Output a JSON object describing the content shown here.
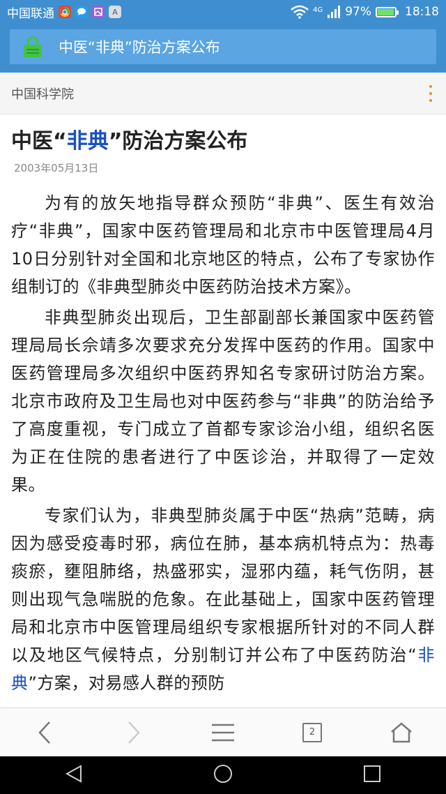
{
  "status_bar": {
    "carrier": "中国联通",
    "app_icons": [
      "chrome-icon",
      "message-icon",
      "gallery-icon",
      "app-a-icon"
    ],
    "app_icon_a_letter": "A",
    "network": "4G",
    "battery": "97%",
    "battery_level": 0.97,
    "time": "18:18"
  },
  "address_bar": {
    "title": "中医“非典”防治方案公布"
  },
  "site_header": {
    "site_name": "中国科学院"
  },
  "article": {
    "title_prefix": "中医“",
    "title_keyword": "非典",
    "title_suffix": "”防治方案公布",
    "date": "2003年05月13日",
    "paragraphs": [
      "为有的放矢地指导群众预防“非典”、医生有效治疗“非典”，国家中医药管理局和北京市中医管理局4月10日分别针对全国和北京地区的特点，公布了专家协作组制订的《非典型肺炎中医药防治技术方案》。",
      "非典型肺炎出现后，卫生部副部长兼国家中医药管理局局长佘靖多次要求充分发挥中医药的作用。国家中医药管理局多次组织中医药界知名专家研讨防治方案。北京市政府及卫生局也对中医药参与“非典”的防治给予了高度重视，专门成立了首都专家诊治小组，组织名医为正在住院的患者进行了中医诊治，并取得了一定效果。",
      "专家们认为，非典型肺炎属于中医“热病”范畴，病因为感受疫毒时邪，病位在肺，基本病机特点为：热毒痰瘀，壅阻肺络，热盛邪实，湿邪内蕴，耗气伤阴，甚则出现气急喘脱的危象。在此基础上，国家中医药管理局和北京市中医管理局组织专家根据所针对的不同人群以及地区气候特点，分别制订并公布了中医药防治“"
    ],
    "p3_link": "非典",
    "p3_tail": "”方案，对易感人群的预防"
  },
  "toolbar": {
    "tabs_count": "2"
  }
}
